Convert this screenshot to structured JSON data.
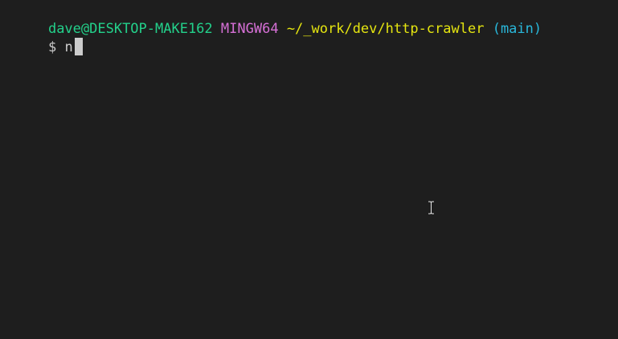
{
  "terminal": {
    "prompt": {
      "user_host": "dave@DESKTOP-MAKE162",
      "environment": "MINGW64",
      "path": "~/_work/dev/http-crawler",
      "branch": "(main)"
    },
    "input": {
      "symbol": "$",
      "typed_text": "n"
    }
  },
  "colors": {
    "background": "#1e1e1e",
    "user_host": "#23d18b",
    "environment": "#d670d6",
    "path": "#e5e510",
    "branch": "#29b8db",
    "text": "#cccccc",
    "cursor": "#cccccc"
  },
  "icons": {
    "mouse_pointer": "text-ibeam-cursor-icon"
  }
}
